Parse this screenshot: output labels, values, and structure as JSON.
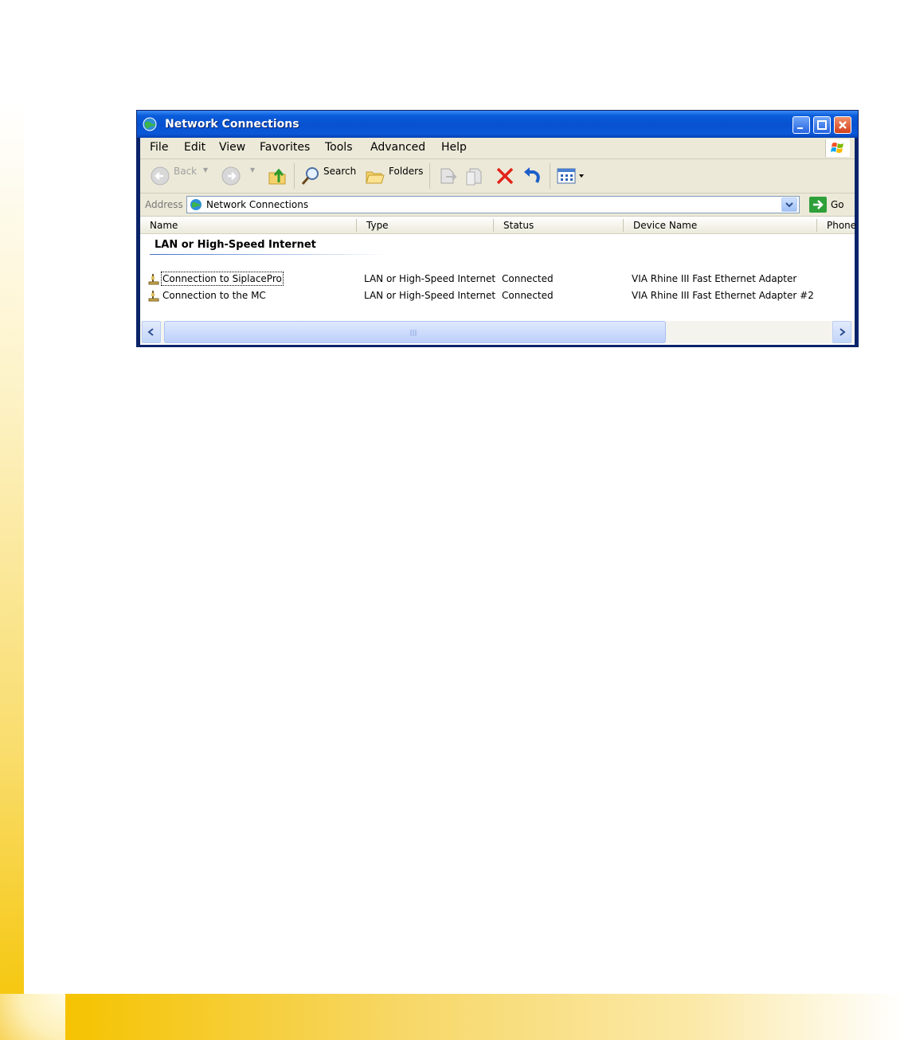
{
  "window": {
    "title": "Network Connections"
  },
  "menubar": {
    "items": [
      "File",
      "Edit",
      "View",
      "Favorites",
      "Tools",
      "Advanced",
      "Help"
    ]
  },
  "toolbar": {
    "back_label": "Back",
    "search_label": "Search",
    "folders_label": "Folders"
  },
  "addressbar": {
    "label": "Address",
    "value": "Network Connections",
    "go_label": "Go"
  },
  "listview": {
    "columns": [
      "Name",
      "Type",
      "Status",
      "Device Name",
      "Phone"
    ],
    "group_title": "LAN or High-Speed Internet",
    "rows": [
      {
        "name": "Connection to SiplacePro",
        "type": "LAN or High-Speed Internet",
        "status": "Connected",
        "device": "VIA Rhine III Fast Ethernet Adapter"
      },
      {
        "name": "Connection to the MC",
        "type": "LAN or High-Speed Internet",
        "status": "Connected",
        "device": "VIA Rhine III Fast Ethernet Adapter #2"
      }
    ]
  },
  "colors": {
    "titlebar": "#0a58d8",
    "accent_yellow": "#f5c400",
    "window_bg": "#ece9d8"
  }
}
